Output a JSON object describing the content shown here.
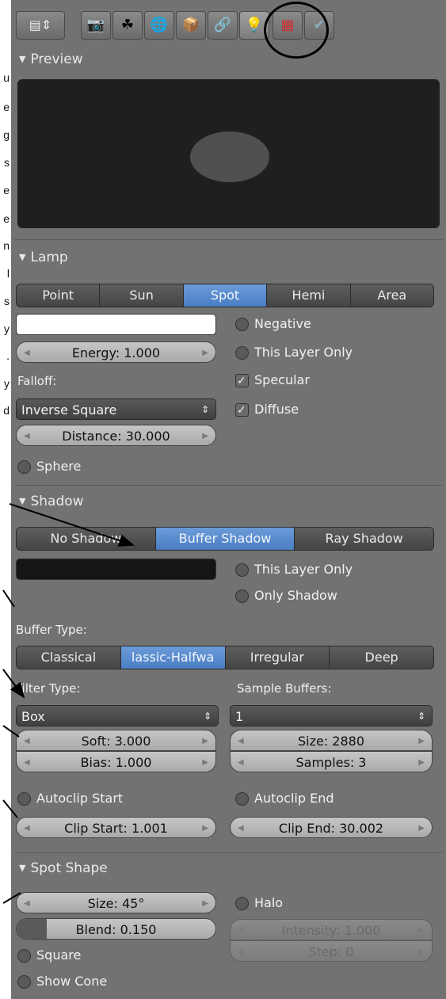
{
  "annotation_letters": [
    "u",
    "e",
    "g",
    "s",
    "e",
    "e",
    "n",
    "l",
    "s",
    "y",
    ".",
    "y",
    "d"
  ],
  "sections": {
    "preview": "Preview",
    "lamp": "Lamp",
    "shadow": "Shadow",
    "spot_shape": "Spot Shape"
  },
  "lamp": {
    "types": [
      "Point",
      "Sun",
      "Spot",
      "Hemi",
      "Area"
    ],
    "selected_type": "Spot",
    "negative": "Negative",
    "energy": "Energy: 1.000",
    "this_layer_only": "This Layer Only",
    "falloff_label": "Falloff:",
    "specular": "Specular",
    "falloff_value": "Inverse Square",
    "diffuse": "Diffuse",
    "distance": "Distance: 30.000",
    "sphere": "Sphere"
  },
  "shadow": {
    "modes": [
      "No Shadow",
      "Buffer Shadow",
      "Ray Shadow"
    ],
    "selected_mode": "Buffer Shadow",
    "this_layer_only": "This Layer Only",
    "only_shadow": "Only Shadow",
    "buffer_type_label": "Buffer Type:",
    "buffer_types": [
      "Classical",
      "lassic-Halfwa",
      "Irregular",
      "Deep"
    ],
    "selected_buffer": "lassic-Halfwa",
    "filter_type_label": "Filter Type:",
    "sample_buffers_label": "Sample Buffers:",
    "filter_value": "Box",
    "sample_buffers_value": "1",
    "soft": "Soft: 3.000",
    "size": "Size: 2880",
    "bias": "Bias: 1.000",
    "samples": "Samples: 3",
    "autoclip_start": "Autoclip Start",
    "autoclip_end": "Autoclip End",
    "clip_start": "Clip Start: 1.001",
    "clip_end": "Clip End: 30.002"
  },
  "spot_shape": {
    "size": "Size: 45°",
    "halo": "Halo",
    "blend": "Blend: 0.150",
    "blend_fraction": 0.15,
    "intensity": "Intensity: 1.000",
    "square": "Square",
    "step": "Step: 0",
    "show_cone": "Show Cone"
  },
  "colors": {
    "panel": "#727272",
    "selected": "#5a8bd0",
    "preview_bg": "#1f1f1f"
  }
}
